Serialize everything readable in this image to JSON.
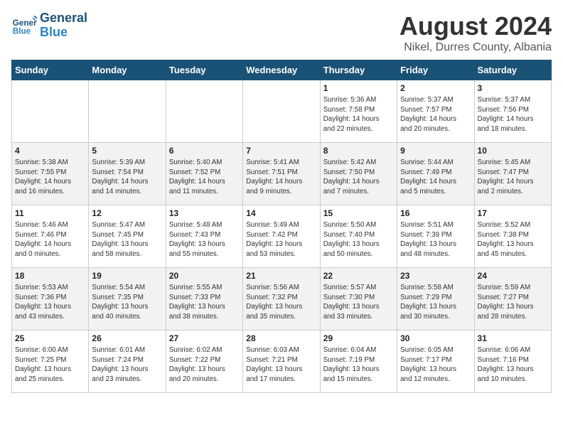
{
  "header": {
    "logo_line1": "General",
    "logo_line2": "Blue",
    "title": "August 2024",
    "subtitle": "Nikel, Durres County, Albania"
  },
  "weekdays": [
    "Sunday",
    "Monday",
    "Tuesday",
    "Wednesday",
    "Thursday",
    "Friday",
    "Saturday"
  ],
  "weeks": [
    [
      {
        "day": "",
        "info": ""
      },
      {
        "day": "",
        "info": ""
      },
      {
        "day": "",
        "info": ""
      },
      {
        "day": "",
        "info": ""
      },
      {
        "day": "1",
        "info": "Sunrise: 5:36 AM\nSunset: 7:58 PM\nDaylight: 14 hours\nand 22 minutes."
      },
      {
        "day": "2",
        "info": "Sunrise: 5:37 AM\nSunset: 7:57 PM\nDaylight: 14 hours\nand 20 minutes."
      },
      {
        "day": "3",
        "info": "Sunrise: 5:37 AM\nSunset: 7:56 PM\nDaylight: 14 hours\nand 18 minutes."
      }
    ],
    [
      {
        "day": "4",
        "info": "Sunrise: 5:38 AM\nSunset: 7:55 PM\nDaylight: 14 hours\nand 16 minutes."
      },
      {
        "day": "5",
        "info": "Sunrise: 5:39 AM\nSunset: 7:54 PM\nDaylight: 14 hours\nand 14 minutes."
      },
      {
        "day": "6",
        "info": "Sunrise: 5:40 AM\nSunset: 7:52 PM\nDaylight: 14 hours\nand 11 minutes."
      },
      {
        "day": "7",
        "info": "Sunrise: 5:41 AM\nSunset: 7:51 PM\nDaylight: 14 hours\nand 9 minutes."
      },
      {
        "day": "8",
        "info": "Sunrise: 5:42 AM\nSunset: 7:50 PM\nDaylight: 14 hours\nand 7 minutes."
      },
      {
        "day": "9",
        "info": "Sunrise: 5:44 AM\nSunset: 7:49 PM\nDaylight: 14 hours\nand 5 minutes."
      },
      {
        "day": "10",
        "info": "Sunrise: 5:45 AM\nSunset: 7:47 PM\nDaylight: 14 hours\nand 2 minutes."
      }
    ],
    [
      {
        "day": "11",
        "info": "Sunrise: 5:46 AM\nSunset: 7:46 PM\nDaylight: 14 hours\nand 0 minutes."
      },
      {
        "day": "12",
        "info": "Sunrise: 5:47 AM\nSunset: 7:45 PM\nDaylight: 13 hours\nand 58 minutes."
      },
      {
        "day": "13",
        "info": "Sunrise: 5:48 AM\nSunset: 7:43 PM\nDaylight: 13 hours\nand 55 minutes."
      },
      {
        "day": "14",
        "info": "Sunrise: 5:49 AM\nSunset: 7:42 PM\nDaylight: 13 hours\nand 53 minutes."
      },
      {
        "day": "15",
        "info": "Sunrise: 5:50 AM\nSunset: 7:40 PM\nDaylight: 13 hours\nand 50 minutes."
      },
      {
        "day": "16",
        "info": "Sunrise: 5:51 AM\nSunset: 7:39 PM\nDaylight: 13 hours\nand 48 minutes."
      },
      {
        "day": "17",
        "info": "Sunrise: 5:52 AM\nSunset: 7:38 PM\nDaylight: 13 hours\nand 45 minutes."
      }
    ],
    [
      {
        "day": "18",
        "info": "Sunrise: 5:53 AM\nSunset: 7:36 PM\nDaylight: 13 hours\nand 43 minutes."
      },
      {
        "day": "19",
        "info": "Sunrise: 5:54 AM\nSunset: 7:35 PM\nDaylight: 13 hours\nand 40 minutes."
      },
      {
        "day": "20",
        "info": "Sunrise: 5:55 AM\nSunset: 7:33 PM\nDaylight: 13 hours\nand 38 minutes."
      },
      {
        "day": "21",
        "info": "Sunrise: 5:56 AM\nSunset: 7:32 PM\nDaylight: 13 hours\nand 35 minutes."
      },
      {
        "day": "22",
        "info": "Sunrise: 5:57 AM\nSunset: 7:30 PM\nDaylight: 13 hours\nand 33 minutes."
      },
      {
        "day": "23",
        "info": "Sunrise: 5:58 AM\nSunset: 7:29 PM\nDaylight: 13 hours\nand 30 minutes."
      },
      {
        "day": "24",
        "info": "Sunrise: 5:59 AM\nSunset: 7:27 PM\nDaylight: 13 hours\nand 28 minutes."
      }
    ],
    [
      {
        "day": "25",
        "info": "Sunrise: 6:00 AM\nSunset: 7:25 PM\nDaylight: 13 hours\nand 25 minutes."
      },
      {
        "day": "26",
        "info": "Sunrise: 6:01 AM\nSunset: 7:24 PM\nDaylight: 13 hours\nand 23 minutes."
      },
      {
        "day": "27",
        "info": "Sunrise: 6:02 AM\nSunset: 7:22 PM\nDaylight: 13 hours\nand 20 minutes."
      },
      {
        "day": "28",
        "info": "Sunrise: 6:03 AM\nSunset: 7:21 PM\nDaylight: 13 hours\nand 17 minutes."
      },
      {
        "day": "29",
        "info": "Sunrise: 6:04 AM\nSunset: 7:19 PM\nDaylight: 13 hours\nand 15 minutes."
      },
      {
        "day": "30",
        "info": "Sunrise: 6:05 AM\nSunset: 7:17 PM\nDaylight: 13 hours\nand 12 minutes."
      },
      {
        "day": "31",
        "info": "Sunrise: 6:06 AM\nSunset: 7:16 PM\nDaylight: 13 hours\nand 10 minutes."
      }
    ]
  ]
}
